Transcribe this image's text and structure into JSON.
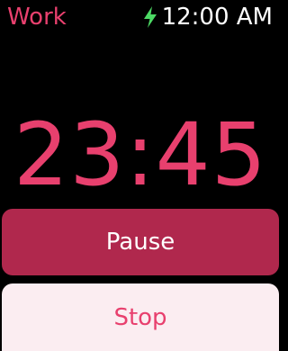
{
  "status_bar": {
    "app_title": "Work",
    "time": "12:00 AM",
    "charging_icon": "bolt-icon"
  },
  "timer": {
    "value": "23:45"
  },
  "actions": {
    "pause_label": "Pause",
    "stop_label": "Stop"
  },
  "colors": {
    "accent": "#e8406e",
    "pause_bg": "#b0284d",
    "stop_bg": "#fbedf1",
    "charging": "#4cd964",
    "background": "#000000"
  }
}
